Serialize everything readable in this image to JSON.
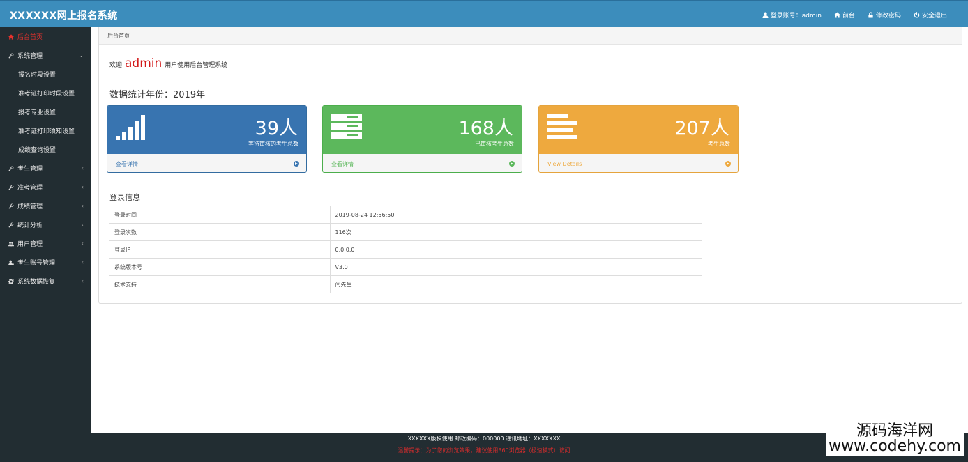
{
  "header": {
    "title": "XXXXXX网上报名系统",
    "nav": [
      {
        "label": "登录账号：admin",
        "icon": "user-icon"
      },
      {
        "label": "前台",
        "icon": "home-icon"
      },
      {
        "label": "修改密码",
        "icon": "lock-icon"
      },
      {
        "label": "安全退出",
        "icon": "power-icon"
      }
    ]
  },
  "sidebar": {
    "items": [
      {
        "label": "后台首页",
        "icon": "home-icon"
      },
      {
        "label": "系统管理",
        "icon": "wrench-icon",
        "caret": "⌄"
      },
      {
        "label": "报名时段设置"
      },
      {
        "label": "准考证打印时段设置"
      },
      {
        "label": "报考专业设置"
      },
      {
        "label": "准考证打印须知设置"
      },
      {
        "label": "成绩查询设置"
      },
      {
        "label": "考生管理",
        "icon": "wrench-icon",
        "caret": "‹"
      },
      {
        "label": "准考管理",
        "icon": "wrench-icon",
        "caret": "‹"
      },
      {
        "label": "成绩管理",
        "icon": "wrench-icon",
        "caret": "‹"
      },
      {
        "label": "统计分析",
        "icon": "wrench-icon",
        "caret": "‹"
      },
      {
        "label": "用户管理",
        "icon": "users-icon",
        "caret": "‹"
      },
      {
        "label": "考生账号管理",
        "icon": "user-cog-icon",
        "caret": "‹"
      },
      {
        "label": "系统数据恢复",
        "icon": "gear-icon",
        "caret": "‹"
      }
    ]
  },
  "main": {
    "breadcrumb": "后台首页",
    "welcome_prefix": "欢迎",
    "welcome_user": "admin",
    "welcome_suffix": "用户使用后台管理系统",
    "stat_title": "数据统计年份：2019年",
    "cards": [
      {
        "value": "39人",
        "desc": "等待审核的考生总数",
        "link": "查看详情",
        "color": "#3874b0",
        "icon": "signal-bars-icon"
      },
      {
        "value": "168人",
        "desc": "已审核考生总数",
        "link": "查看详情",
        "color": "#5cb85c",
        "icon": "server-icon"
      },
      {
        "value": "207人",
        "desc": "考生总数",
        "link": "View Details",
        "color": "#eea93e",
        "icon": "align-left-icon"
      }
    ],
    "login_title": "登录信息",
    "login_rows": [
      {
        "key": "登录时间",
        "value": "2019-08-24 12:56:50"
      },
      {
        "key": "登录次数",
        "value": "116次"
      },
      {
        "key": "登录IP",
        "value": "0.0.0.0"
      },
      {
        "key": "系统版本号",
        "value": "V3.0"
      },
      {
        "key": "技术支持",
        "value": "闫先生"
      }
    ]
  },
  "footer": {
    "line1": "XXXXXX版权使用  邮政编码：000000  通讯地址：XXXXXXX",
    "line2": "温馨提示：为了您的浏览效果，建议使用360浏览器（极速模式）访问"
  },
  "watermark": {
    "line1": "源码海洋网",
    "line2": "www.codehy.com"
  }
}
